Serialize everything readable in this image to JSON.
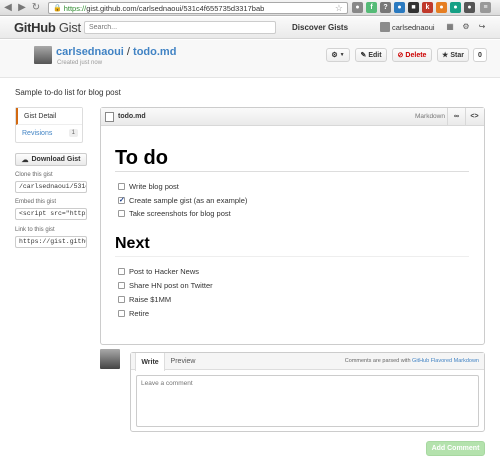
{
  "browser": {
    "url_scheme": "https://",
    "url_rest": "gist.github.com/carlsednaoui/531c4f655735d3317bab"
  },
  "header": {
    "logo_main": "GitHub",
    "logo_sub": "Gist",
    "search_placeholder": "Search...",
    "discover": "Discover Gists",
    "username": "carlsednaoui"
  },
  "gist": {
    "owner": "carlsednaoui",
    "separator": "/",
    "filename": "todo.md",
    "created": "Created just now",
    "edit": "Edit",
    "delete": "Delete",
    "star": "Star",
    "star_count": "0",
    "description": "Sample to-do list for blog post"
  },
  "sidebar": {
    "detail": "Gist Detail",
    "revisions": "Revisions",
    "revisions_count": "1",
    "download": "Download Gist",
    "clone_label": "Clone this gist",
    "clone_value": "/carlsednaoui/531c4f",
    "embed_label": "Embed this gist",
    "embed_value": "<script src=\"https:",
    "link_label": "Link to this gist",
    "link_value": "https://gist.github"
  },
  "file": {
    "name": "todo.md",
    "language": "Markdown",
    "h1": "To do",
    "tasks1": [
      {
        "text": "Write blog post",
        "checked": false
      },
      {
        "text": "Create sample gist (as an example)",
        "checked": true
      },
      {
        "text": "Take screenshots for blog post",
        "checked": false
      }
    ],
    "h2": "Next",
    "tasks2": [
      {
        "text": "Post to Hacker News",
        "checked": false
      },
      {
        "text": "Share HN post on Twitter",
        "checked": false
      },
      {
        "text": "Raise $1MM",
        "checked": false
      },
      {
        "text": "Retire",
        "checked": false
      }
    ]
  },
  "comment": {
    "write": "Write",
    "preview": "Preview",
    "note_prefix": "Comments are parsed with ",
    "note_link": "GitHub Flavored Markdown",
    "placeholder": "Leave a comment",
    "submit": "Add Comment"
  },
  "colors": {
    "link": "#4183c4",
    "accent": "#d26911",
    "delete": "#cc0000",
    "add_comment_bg": "#b4e2ad"
  }
}
